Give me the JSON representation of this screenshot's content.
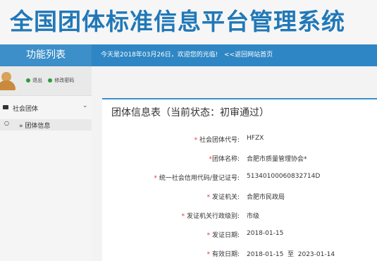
{
  "header": {
    "system_title": "全国团体标准信息平台管理系统"
  },
  "topbar": {
    "func_title": "功能列表",
    "welcome": "今天是2018年03月26日，欢迎您的光临!",
    "back_link": "<<返回网站首页"
  },
  "user": {
    "logout": "退出",
    "change_password": "修改密码"
  },
  "sidebar": {
    "group_label": "社会团体",
    "item_label": "» 团体信息"
  },
  "content": {
    "title": "团体信息表（当前状态：初审通过）",
    "fields": [
      {
        "label": "社会团体代号:",
        "value": "HFZX"
      },
      {
        "label": "团体名称:",
        "value": "合肥市质量管理协会*"
      },
      {
        "label": "统一社会信用代码/登记证号:",
        "value": "51340100060832714D"
      },
      {
        "label": "发证机关:",
        "value": "合肥市民政局"
      },
      {
        "label": "发证机关行政级别:",
        "value": "市级"
      },
      {
        "label": "发证日期:",
        "value": "2018-01-15"
      },
      {
        "label": "有效日期:",
        "value": "2018-01-15  至  2023-01-14"
      }
    ],
    "required_mark": "*"
  },
  "colors": {
    "title_blue": "#2178b8",
    "bar_blue": "#2e86c4",
    "required_red": "#ee3333",
    "status_green": "#2e9b3a"
  }
}
